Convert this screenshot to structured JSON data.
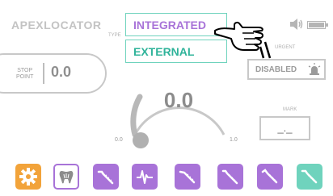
{
  "header": {
    "title": "APEXLOCATOR",
    "type_label": "TYPE"
  },
  "type_dropdown": {
    "options": [
      "INTEGRATED",
      "EXTERNAL"
    ],
    "highlighted": "INTEGRATED"
  },
  "stop_point": {
    "label_line1": "STOP",
    "label_line2": "POINT",
    "value": "0.0"
  },
  "gauge": {
    "value": "0.0",
    "min_label": "0.0",
    "max_label": "1.0",
    "level": 0
  },
  "urgent": {
    "label": "URGENT",
    "value": "DISABLED"
  },
  "mark": {
    "label": "MARK",
    "value": "_._"
  },
  "toolbar": {
    "items": [
      {
        "name": "settings",
        "color": "#f2a33a",
        "icon": "gear-icon"
      },
      {
        "name": "tooth",
        "color": "#a873d8",
        "icon": "tooth-icon",
        "selected": true
      },
      {
        "name": "file-1",
        "color": "#a873d8",
        "icon": "endo-file-icon"
      },
      {
        "name": "apex-graph",
        "color": "#a873d8",
        "icon": "apex-graph-icon"
      },
      {
        "name": "file-2",
        "color": "#a873d8",
        "icon": "endo-file-icon"
      },
      {
        "name": "file-3",
        "color": "#a873d8",
        "icon": "endo-file-icon"
      },
      {
        "name": "file-4",
        "color": "#a873d8",
        "icon": "endo-file-icon"
      },
      {
        "name": "file-5",
        "color": "#6fd3bd",
        "icon": "endo-file-icon"
      }
    ]
  },
  "colors": {
    "accent_purple": "#a873d8",
    "accent_teal": "#6fd3bd",
    "accent_orange": "#f2a33a",
    "text_gray": "#8c8c8c"
  }
}
